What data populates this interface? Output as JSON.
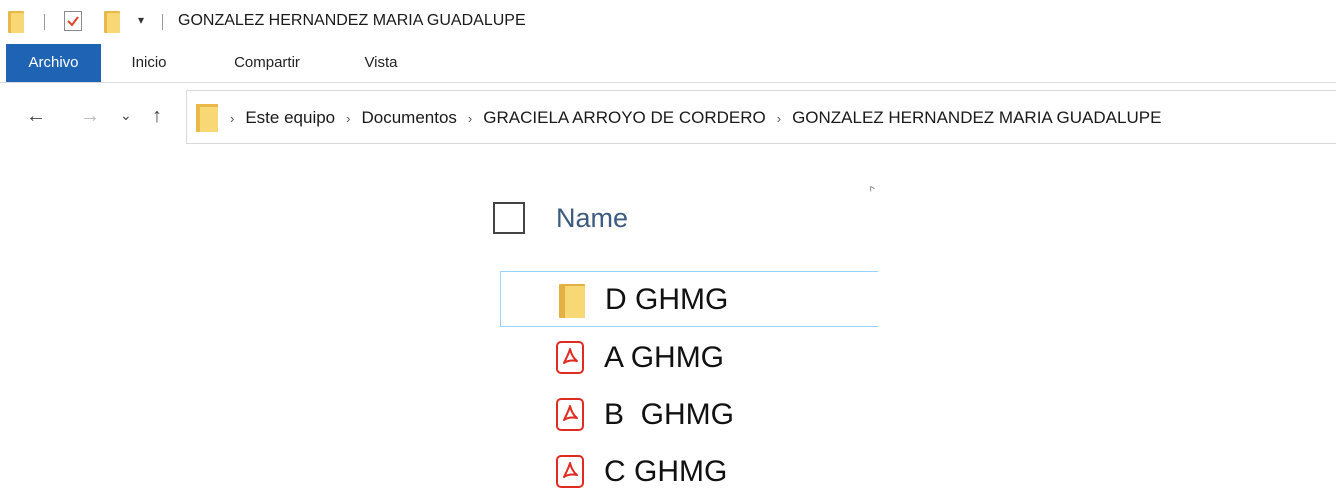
{
  "window": {
    "title": "GONZALEZ HERNANDEZ MARIA GUADALUPE",
    "quick_access_dropdown": "▾"
  },
  "ribbon": {
    "tabs": [
      {
        "label": "Archivo",
        "active": true
      },
      {
        "label": "Inicio",
        "active": false
      },
      {
        "label": "Compartir",
        "active": false
      },
      {
        "label": "Vista",
        "active": false
      }
    ]
  },
  "navigation": {
    "back": "←",
    "forward": "→",
    "recent": "⌄",
    "up": "↑",
    "breadcrumb": [
      "Este equipo",
      "Documentos",
      "GRACIELA ARROYO DE CORDERO",
      "GONZALEZ HERNANDEZ MARIA GUADALUPE"
    ],
    "separator": "›"
  },
  "file_list": {
    "column_header": "Name",
    "sort_indicator": "^",
    "items": [
      {
        "name": "D GHMG",
        "type": "folder",
        "icon": "folder-icon",
        "selected": true
      },
      {
        "name": "A GHMG",
        "type": "pdf",
        "icon": "pdf-file-icon",
        "selected": false
      },
      {
        "name": "B  GHMG",
        "type": "pdf",
        "icon": "pdf-file-icon",
        "selected": false
      },
      {
        "name": "C GHMG",
        "type": "pdf",
        "icon": "pdf-file-icon",
        "selected": false
      }
    ]
  },
  "colors": {
    "accent": "#1f63b5",
    "selection_border": "#99d1ff",
    "folder": "#f8d775",
    "pdf_red": "#e02b20",
    "header_text": "#3d5a80"
  }
}
